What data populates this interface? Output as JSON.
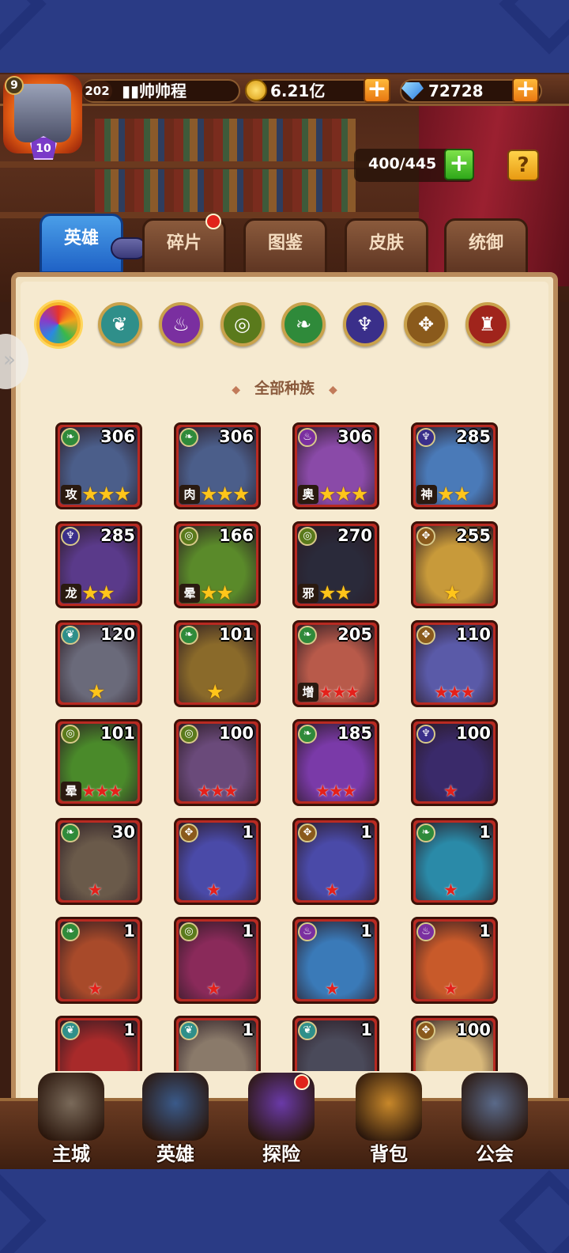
{
  "player": {
    "avatar_level": "9",
    "vip_level": "10",
    "level": "202",
    "name": "▮▮帅帅程"
  },
  "resources": {
    "gold": "6.21亿",
    "diamonds": "72728",
    "plus": "+"
  },
  "capacity": {
    "text": "400/445",
    "plus": "+",
    "help": "?"
  },
  "tabs": [
    "英雄",
    "碎片",
    "图鉴",
    "皮肤",
    "统御"
  ],
  "race_filter_title": "全部种族",
  "race_filters": [
    {
      "name": "all",
      "color": "#ffffff"
    },
    {
      "name": "forest-spirit",
      "color": "#2f8f8a"
    },
    {
      "name": "shadow",
      "color": "#7a2fa0"
    },
    {
      "name": "eye",
      "color": "#5a7a1c"
    },
    {
      "name": "nature",
      "color": "#2f8a3a"
    },
    {
      "name": "abyss",
      "color": "#3a2f8a"
    },
    {
      "name": "light",
      "color": "#8a5a1c"
    },
    {
      "name": "fortress",
      "color": "#a0241c"
    }
  ],
  "heroes": [
    {
      "level": "306",
      "race": "nature",
      "tag": "攻",
      "stars": "★★★",
      "star_type": "gold",
      "color": "#4b5e8a"
    },
    {
      "level": "306",
      "race": "nature",
      "tag": "肉",
      "stars": "★★★",
      "star_type": "gold",
      "color": "#4b5e8a"
    },
    {
      "level": "306",
      "race": "shadow",
      "tag": "奥",
      "stars": "★★★",
      "star_type": "gold",
      "color": "#8a4aa8"
    },
    {
      "level": "285",
      "race": "abyss",
      "tag": "神",
      "stars": "★★",
      "star_type": "gold",
      "color": "#4a7ab8"
    },
    {
      "level": "285",
      "race": "abyss",
      "tag": "龙",
      "stars": "★★",
      "star_type": "gold",
      "color": "#5a3a8a"
    },
    {
      "level": "166",
      "race": "eye",
      "tag": "晕",
      "stars": "★★",
      "star_type": "gold",
      "color": "#5a8a2a"
    },
    {
      "level": "270",
      "race": "eye",
      "tag": "邪",
      "stars": "★★",
      "star_type": "gold",
      "color": "#2a2a3a"
    },
    {
      "level": "255",
      "race": "light",
      "tag": "",
      "stars": "★",
      "star_type": "gold",
      "color": "#c89a3a"
    },
    {
      "level": "120",
      "race": "forest-spirit",
      "tag": "",
      "stars": "★",
      "star_type": "gold",
      "color": "#6a6a7a"
    },
    {
      "level": "101",
      "race": "nature",
      "tag": "",
      "stars": "★",
      "star_type": "gold",
      "color": "#8a6a2a"
    },
    {
      "level": "205",
      "race": "nature",
      "tag": "增",
      "stars": "★★★",
      "star_type": "red",
      "color": "#b85a4a"
    },
    {
      "level": "110",
      "race": "light",
      "tag": "",
      "stars": "★★★",
      "star_type": "red",
      "color": "#5a5aa8"
    },
    {
      "level": "101",
      "race": "eye",
      "tag": "晕",
      "stars": "★★★",
      "star_type": "red",
      "color": "#4a8a2a"
    },
    {
      "level": "100",
      "race": "eye",
      "tag": "",
      "stars": "★★★",
      "star_type": "red",
      "color": "#6a4a7a"
    },
    {
      "level": "185",
      "race": "nature",
      "tag": "",
      "stars": "★★★",
      "star_type": "red",
      "color": "#7a3aa8"
    },
    {
      "level": "100",
      "race": "abyss",
      "tag": "",
      "stars": "★",
      "star_type": "red",
      "color": "#3a2a6a"
    },
    {
      "level": "30",
      "race": "nature",
      "tag": "",
      "stars": "★",
      "star_type": "red",
      "color": "#6a5a4a"
    },
    {
      "level": "1",
      "race": "light",
      "tag": "",
      "stars": "★",
      "star_type": "red",
      "color": "#4a4aa8"
    },
    {
      "level": "1",
      "race": "light",
      "tag": "",
      "stars": "★",
      "star_type": "red",
      "color": "#4a4aa8"
    },
    {
      "level": "1",
      "race": "nature",
      "tag": "",
      "stars": "★",
      "star_type": "red",
      "color": "#2a8aa8"
    },
    {
      "level": "1",
      "race": "nature",
      "tag": "",
      "stars": "★",
      "star_type": "red",
      "color": "#a84a2a"
    },
    {
      "level": "1",
      "race": "eye",
      "tag": "",
      "stars": "★",
      "star_type": "red",
      "color": "#8a2a5a"
    },
    {
      "level": "1",
      "race": "shadow",
      "tag": "",
      "stars": "★",
      "star_type": "red",
      "color": "#3a7ab8"
    },
    {
      "level": "1",
      "race": "shadow",
      "tag": "",
      "stars": "★",
      "star_type": "red",
      "color": "#c85a2a"
    },
    {
      "level": "1",
      "race": "forest-spirit",
      "tag": "",
      "stars": "",
      "star_type": "red",
      "color": "#a82a2a"
    },
    {
      "level": "1",
      "race": "forest-spirit",
      "tag": "",
      "stars": "",
      "star_type": "red",
      "color": "#8a7a6a"
    },
    {
      "level": "1",
      "race": "forest-spirit",
      "tag": "",
      "stars": "",
      "star_type": "red",
      "color": "#4a4a5a"
    },
    {
      "level": "100",
      "race": "light",
      "tag": "",
      "stars": "",
      "star_type": "red",
      "color": "#d8b87a"
    }
  ],
  "bottom_nav": [
    {
      "label": "主城",
      "name": "main-city",
      "color": "#7a6a5a"
    },
    {
      "label": "英雄",
      "name": "heroes",
      "color": "#3a5a8a"
    },
    {
      "label": "探险",
      "name": "adventure",
      "color": "#6a3aa8"
    },
    {
      "label": "背包",
      "name": "backpack",
      "color": "#c8882a"
    },
    {
      "label": "公会",
      "name": "guild",
      "color": "#5a6a8a"
    }
  ]
}
